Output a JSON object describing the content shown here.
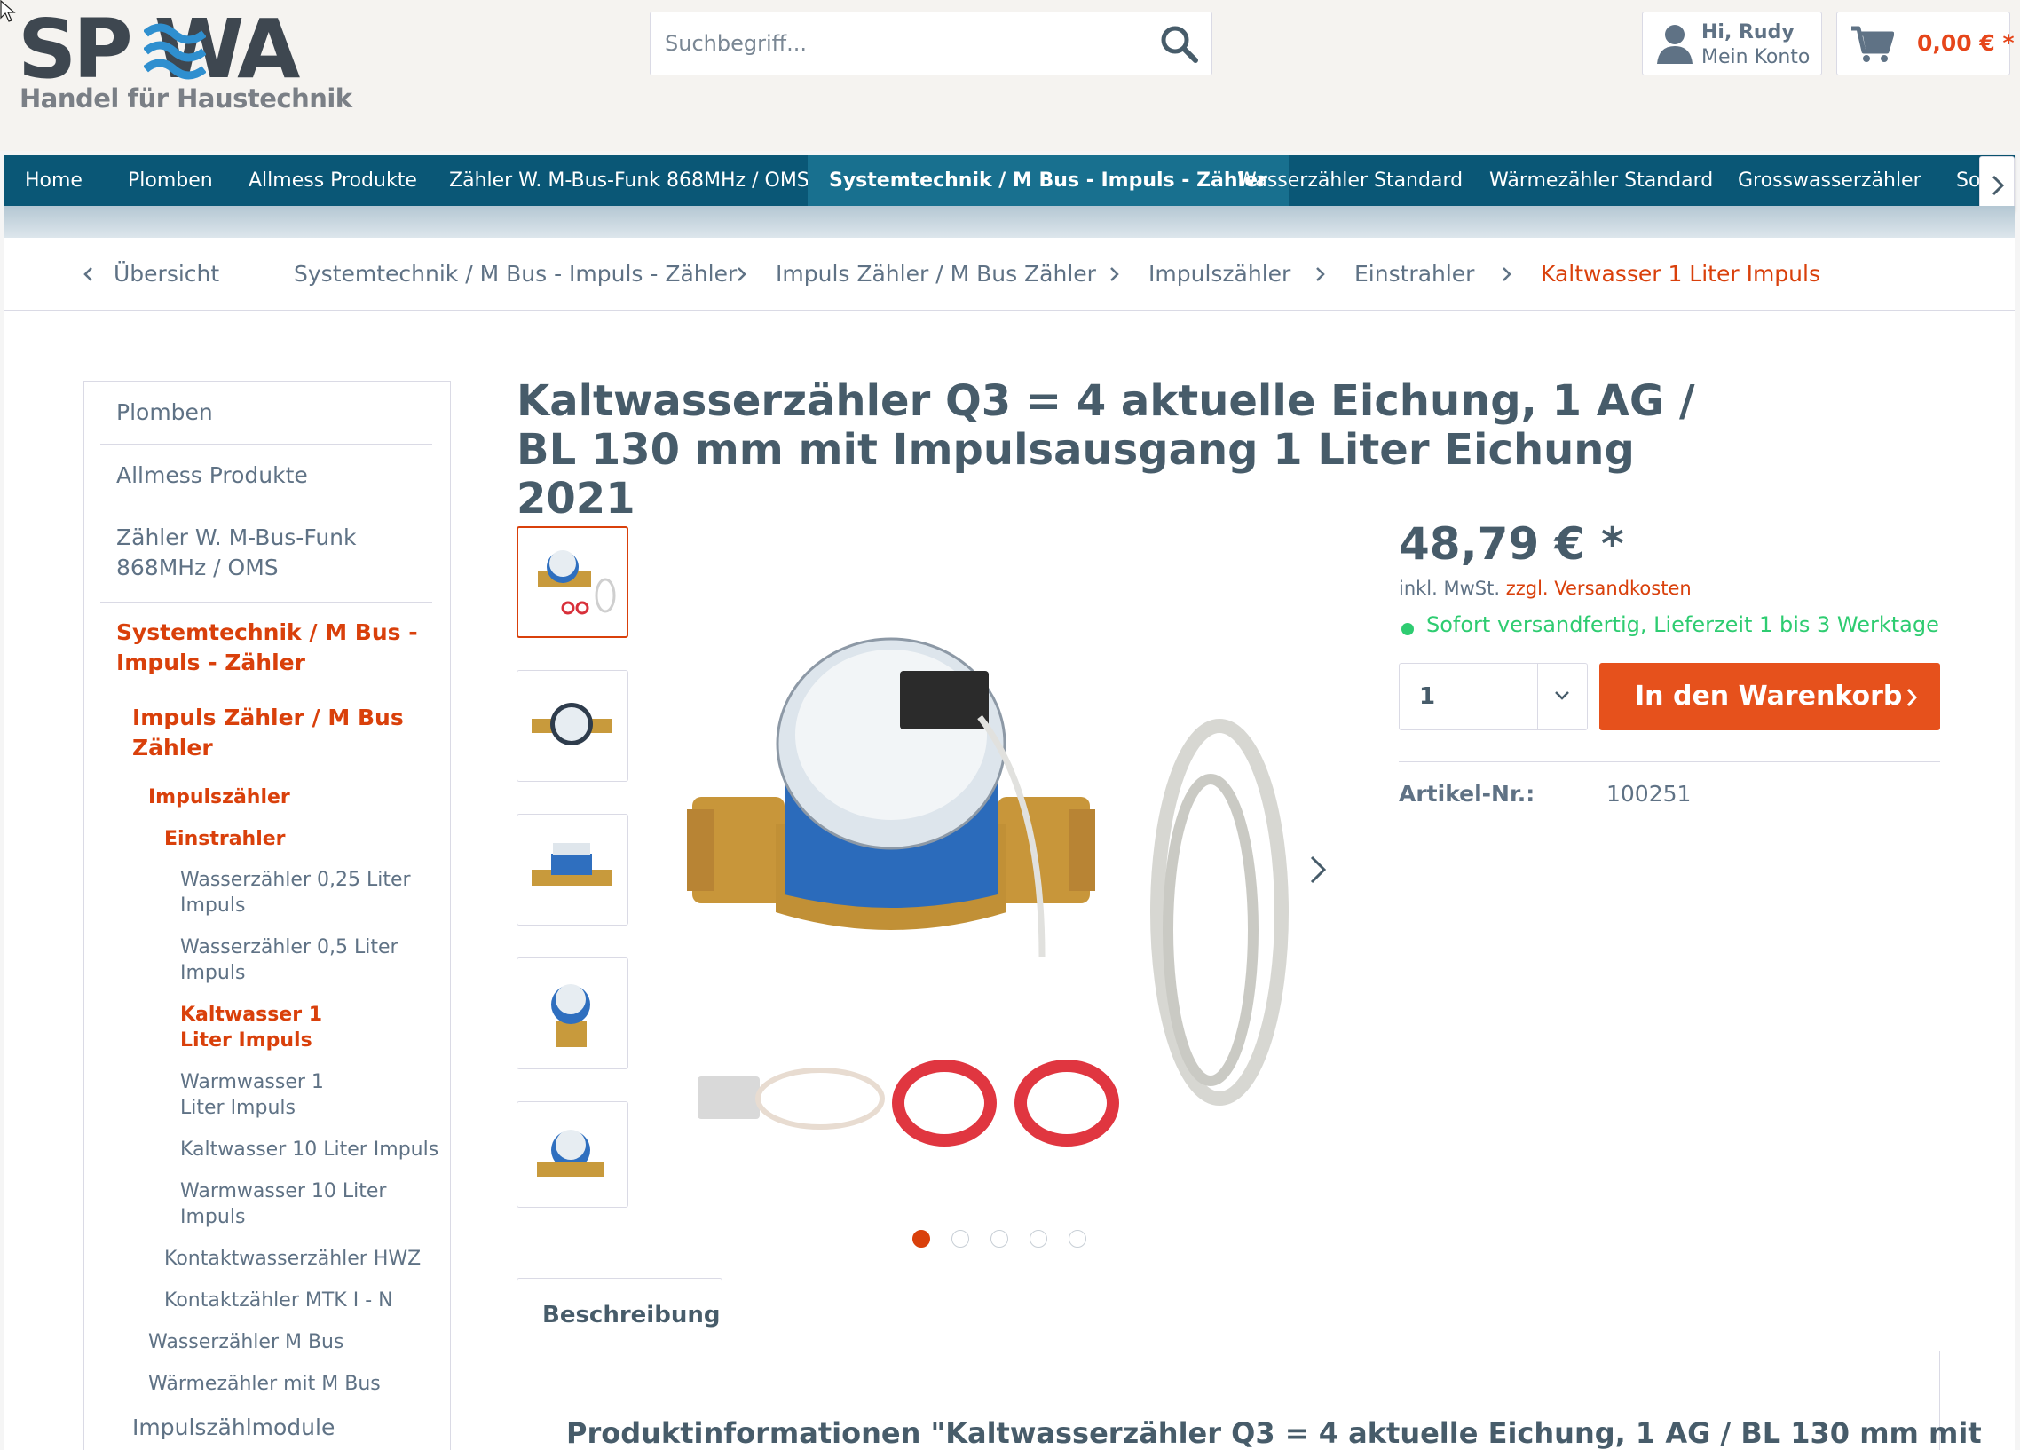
{
  "header": {
    "logo_main": "SP  WA",
    "logo_sub": "Handel für Haustechnik",
    "search_placeholder": "Suchbegriff...",
    "account_greeting": "Hi, Rudy",
    "account_label": "Mein Konto",
    "cart_amount": "0,00 € *"
  },
  "nav": {
    "items": [
      {
        "label": "Home"
      },
      {
        "label": "Plomben"
      },
      {
        "label": "Allmess Produkte"
      },
      {
        "label": "Zähler W. M-Bus-Funk 868MHz / OMS"
      },
      {
        "label": "Systemtechnik / M Bus - Impuls - Zähler"
      },
      {
        "label": "Wasserzähler Standard"
      },
      {
        "label": "Wärmezähler Standard"
      },
      {
        "label": "Grosswasserzähler"
      },
      {
        "label": "Son"
      }
    ]
  },
  "breadcrumb": {
    "back_label": "Übersicht",
    "items": [
      {
        "label": "Systemtechnik / M Bus - Impuls - Zähler"
      },
      {
        "label": "Impuls Zähler / M Bus Zähler"
      },
      {
        "label": "Impulszähler"
      },
      {
        "label": "Einstrahler"
      },
      {
        "label": "Kaltwasser 1 Liter Impuls"
      }
    ]
  },
  "sidebar": {
    "items": [
      {
        "label": "Plomben"
      },
      {
        "label": "Allmess Produkte"
      },
      {
        "label": "Zähler W. M-Bus-Funk 868MHz / OMS"
      },
      {
        "label": "Systemtechnik / M Bus - Impuls - Zähler"
      },
      {
        "label": "Impuls Zähler / M Bus Zähler"
      },
      {
        "label": "Impulszähler"
      },
      {
        "label": "Einstrahler"
      },
      {
        "label": "Wasserzähler 0,25 Liter Impuls"
      },
      {
        "label": "Wasserzähler 0,5 Liter Impuls"
      },
      {
        "label": "Kaltwasser 1 Liter Impuls"
      },
      {
        "label": "Warmwasser 1 Liter Impuls"
      },
      {
        "label": "Kaltwasser 10 Liter Impuls"
      },
      {
        "label": "Warmwasser 10 Liter Impuls"
      },
      {
        "label": "Kontaktwasserzähler HWZ"
      },
      {
        "label": "Kontaktzähler MTK I - N"
      },
      {
        "label": "Wasserzähler M Bus"
      },
      {
        "label": "Wärmezähler mit M Bus"
      },
      {
        "label": "Impulszählmodule"
      }
    ]
  },
  "product": {
    "title": "Kaltwasserzähler Q3 = 4 aktuelle Eichung, 1 AG / BL 130 mm mit Impulsausgang 1 Liter Eichung 2021",
    "price": "48,79 € *",
    "tax_text": "inkl. MwSt.",
    "shipping_link": "zzgl. Versandkosten",
    "delivery": "Sofort versandfertig, Lieferzeit 1 bis 3 Werktage",
    "quantity": "1",
    "buy_label": "In den Warenkorb",
    "article_label": "Artikel-Nr.:",
    "article_number": "100251",
    "image_count": 5,
    "active_image": 1
  },
  "tabs": {
    "description_label": "Beschreibung",
    "description_heading": "Produktinformationen \"Kaltwasserzähler Q3 = 4 aktuelle Eichung, 1 AG / BL 130 mm mit"
  },
  "colors": {
    "brand_blue": "#0a5776",
    "accent_orange": "#e6511c",
    "active_red": "#d9400b",
    "in_stock_green": "#2ecc71"
  }
}
